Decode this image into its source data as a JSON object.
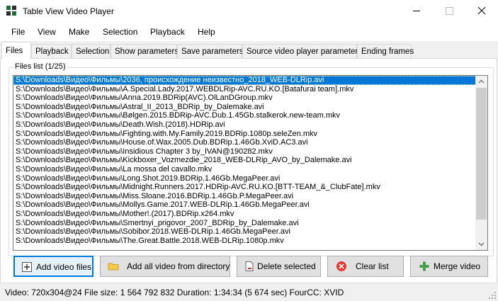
{
  "window": {
    "title": "Table View Video Player",
    "icon": "app-grid-icon"
  },
  "menu": [
    "File",
    "View",
    "Make",
    "Selection",
    "Playback",
    "Help"
  ],
  "tabs": [
    "Files",
    "Playback",
    "Selection",
    "Show parameters",
    "Save parameters",
    "Source video player parameters",
    "Ending frames"
  ],
  "active_tab": "Files",
  "files_group": {
    "label": "Files list (1/25)",
    "items": [
      "S:\\Downloads\\Видео\\Фильмы\\2036, происхождение неизвестно_2018_WEB-DLRip.avi",
      "S:\\Downloads\\Видео\\Фильмы\\A.Special.Lady.2017.WEBDLRip-AVC.RU.KO.[Batafurai team].mkv",
      "S:\\Downloads\\Видео\\Фильмы\\Anna.2019.BDRip(AVC).OlLanDGroup.mkv",
      "S:\\Downloads\\Видео\\Фильмы\\Astral_II_2013_BDRip_by_Dalemake.avi",
      "S:\\Downloads\\Видео\\Фильмы\\Bølgen.2015.BDRip-AVC.Dub.1.45Gb.stalkerok.new-team.mkv",
      "S:\\Downloads\\Видео\\Фильмы\\Death.Wish.(2018).HDRip.avi",
      "S:\\Downloads\\Видео\\Фильмы\\Fighting.with.My.Family.2019.BDRip.1080p.seleZen.mkv",
      "S:\\Downloads\\Видео\\Фильмы\\House.of.Wax.2005.Dub.BDRip.1.46Gb.XviD.AC3.avi",
      "S:\\Downloads\\Видео\\Фильмы\\Insidious Chapter 3 by_IVAN@190282.mkv",
      "S:\\Downloads\\Видео\\Фильмы\\Kickboxer_Vozmezdie_2018_WEB-DLRip_AVO_by_Dalemake.avi",
      "S:\\Downloads\\Видео\\Фильмы\\La mossa del cavallo.mkv",
      "S:\\Downloads\\Видео\\Фильмы\\Long.Shot.2019.BDRip.1.46Gb.MegaPeer.avi",
      "S:\\Downloads\\Видео\\Фильмы\\Midnight.Runners.2017.HDRip-AVC.RU.KO.[BTT-TEAM_&_ClubFate].mkv",
      "S:\\Downloads\\Видео\\Фильмы\\Miss.Sloane.2016.BDRip.1.46Gb.P.MegaPeer.avi",
      "S:\\Downloads\\Видео\\Фильмы\\Mollys.Game.2017.WEB-DLRip.1.46Gb.MegaPeer.avi",
      "S:\\Downloads\\Видео\\Фильмы\\Mother!.(2017).BDRip.x264.mkv",
      "S:\\Downloads\\Видео\\Фильмы\\Smertnyi_prigovor_2007_BDRip_by_Dalemake.avi",
      "S:\\Downloads\\Видео\\Фильмы\\Sobibor.2018.WEB-DLRip.1.46Gb.MegaPeer.avi",
      "S:\\Downloads\\Видео\\Фильмы\\The.Great.Battle.2018.WEB-DLRip.1080p.mkv"
    ],
    "selected_index": 0
  },
  "buttons": {
    "add_video": "Add video files",
    "add_all": "Add all video from directory",
    "delete": "Delete selected",
    "clear": "Clear list",
    "merge": "Merge video"
  },
  "status": {
    "text": "Video: 720x304@24  File size: 1 564 792 832  Duration: 1:34:34 (5 674 sec)  FourCC: XVID"
  },
  "colors": {
    "selection": "#0078d7",
    "clear_icon": "#e53935",
    "merge_icon": "#43a047",
    "folder_icon": "#f2c94c"
  }
}
